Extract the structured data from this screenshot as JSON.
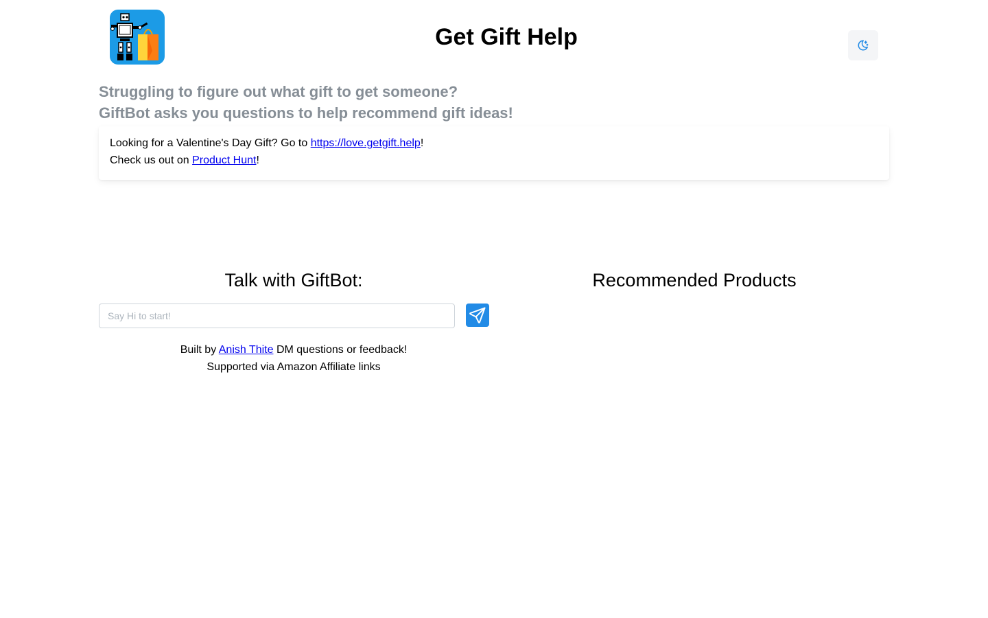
{
  "header": {
    "title": "Get Gift Help",
    "logo_icon": "giftbot-robot-with-shopping-bag-logo",
    "theme_toggle_icon": "moon-icon"
  },
  "tagline": {
    "line1": "Struggling to figure out what gift to get someone?",
    "line2": "GiftBot asks you questions to help recommend gift ideas!"
  },
  "notice": {
    "line1_prefix": "Looking for a Valentine's Day Gift? Go to ",
    "line1_link": "https://love.getgift.help",
    "line1_suffix": "!",
    "line2_prefix": "Check us out on ",
    "line2_link": "Product Hunt",
    "line2_suffix": "!"
  },
  "chat": {
    "heading": "Talk with GiftBot:",
    "input_placeholder": "Say Hi to start!",
    "input_value": "",
    "send_icon": "paper-plane-icon"
  },
  "footer": {
    "built_by_prefix": "Built by ",
    "author_link": "Anish Thite",
    "built_by_suffix": " DM questions or feedback!",
    "supported_text": "Supported via Amazon Affiliate links"
  },
  "recommendations": {
    "heading": "Recommended Products",
    "items": []
  },
  "colors": {
    "accent": "#228be6",
    "tagline": "#868e96",
    "link": "#0000ee",
    "logo_background": "#1c9be6"
  }
}
